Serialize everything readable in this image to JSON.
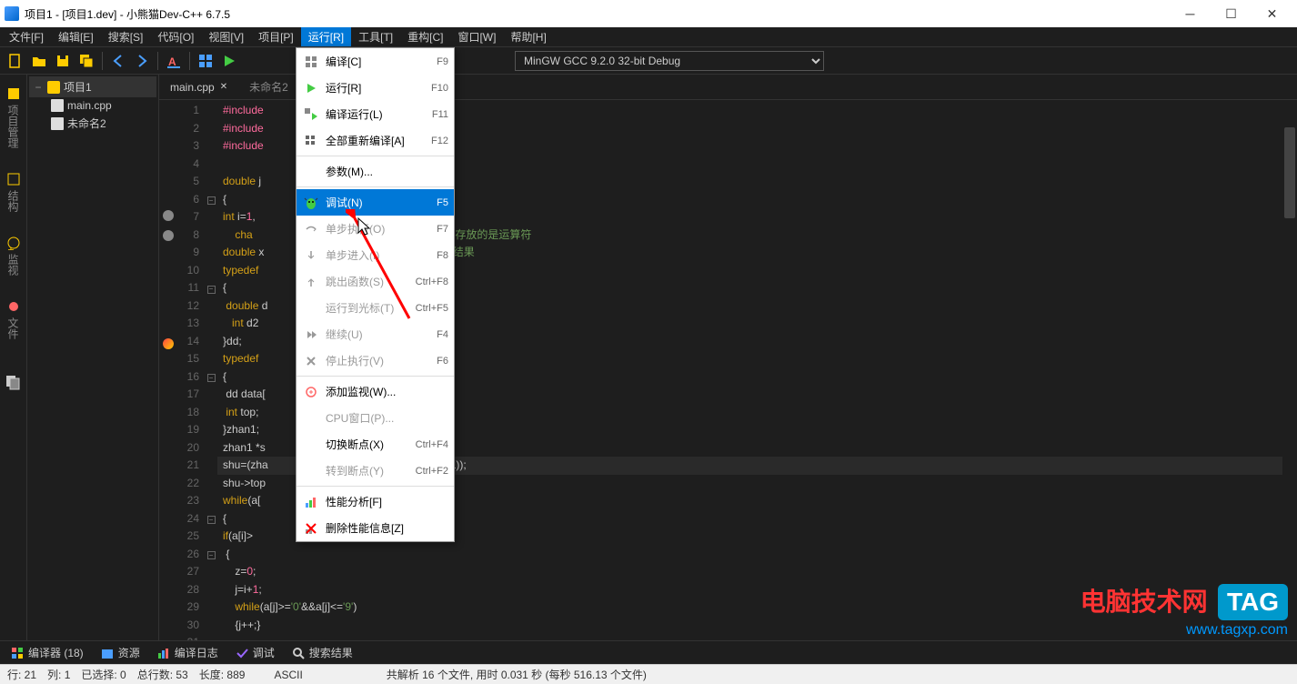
{
  "window": {
    "title": "项目1 - [项目1.dev] - 小熊猫Dev-C++ 6.7.5"
  },
  "menubar": [
    {
      "label": "文件[F]"
    },
    {
      "label": "编辑[E]"
    },
    {
      "label": "搜索[S]"
    },
    {
      "label": "代码[O]"
    },
    {
      "label": "视图[V]"
    },
    {
      "label": "项目[P]"
    },
    {
      "label": "运行[R]",
      "active": true
    },
    {
      "label": "工具[T]"
    },
    {
      "label": "重构[C]"
    },
    {
      "label": "窗口[W]"
    },
    {
      "label": "帮助[H]"
    }
  ],
  "compiler": "MinGW GCC 9.2.0 32-bit Debug",
  "sidebar_tabs": [
    "项目管理",
    "结构",
    "监视",
    "文件"
  ],
  "project_tree": {
    "root": "项目1",
    "files": [
      "main.cpp",
      "未命名2"
    ]
  },
  "editor_tabs": [
    {
      "label": "main.cpp",
      "active": true
    },
    {
      "label": "未命名2"
    }
  ],
  "run_menu": [
    {
      "label": "编译[C]",
      "shortcut": "F9",
      "icon": "compile"
    },
    {
      "label": "运行[R]",
      "shortcut": "F10",
      "icon": "run"
    },
    {
      "label": "编译运行(L)",
      "shortcut": "F11",
      "icon": "compile-run"
    },
    {
      "label": "全部重新编译[A]",
      "shortcut": "F12",
      "icon": "rebuild"
    },
    {
      "sep": true
    },
    {
      "label": "参数(M)...",
      "shortcut": ""
    },
    {
      "sep": true
    },
    {
      "label": "调试(N)",
      "shortcut": "F5",
      "icon": "debug",
      "highlight": true
    },
    {
      "label": "单步执行(O)",
      "shortcut": "F7",
      "icon": "step-over",
      "disabled": true
    },
    {
      "label": "单步进入(I)",
      "shortcut": "F8",
      "icon": "step-into",
      "disabled": true
    },
    {
      "label": "跳出函数(S)",
      "shortcut": "Ctrl+F8",
      "icon": "step-out",
      "disabled": true
    },
    {
      "label": "运行到光标(T)",
      "shortcut": "Ctrl+F5",
      "disabled": true
    },
    {
      "label": "继续(U)",
      "shortcut": "F4",
      "icon": "continue",
      "disabled": true
    },
    {
      "label": "停止执行(V)",
      "shortcut": "F6",
      "icon": "stop",
      "disabled": true
    },
    {
      "sep": true
    },
    {
      "label": "添加监视(W)...",
      "icon": "watch"
    },
    {
      "label": "CPU窗口(P)...",
      "disabled": true
    },
    {
      "label": "切换断点(X)",
      "shortcut": "Ctrl+F4"
    },
    {
      "label": "转到断点(Y)",
      "shortcut": "Ctrl+F2",
      "disabled": true
    },
    {
      "sep": true
    },
    {
      "label": "性能分析[F]",
      "icon": "profile"
    },
    {
      "label": "删除性能信息[Z]",
      "icon": "delete-profile"
    }
  ],
  "code": {
    "lines": [
      {
        "n": 1,
        "html": "<span class='pp'>#include</span>"
      },
      {
        "n": 2,
        "html": "<span class='pp'>#include</span>"
      },
      {
        "n": 3,
        "html": "<span class='pp'>#include</span>"
      },
      {
        "n": 4,
        "html": ""
      },
      {
        "n": 5,
        "html": "<span class='ty'>double</span> <span class='id'>j</span>"
      },
      {
        "n": 6,
        "html": "<span class='pun'>{</span>",
        "fold": "-"
      },
      {
        "n": 7,
        "html": "<span class='ty'>int</span> <span class='id'>i=</span><span class='num'>1</span><span class='pun'>,</span>",
        "bp": true,
        "tail": "<span class='num'>0</span><span class='pun'>,</span><span class='id'>t3=</span><span class='num'>0</span><span class='pun'>;</span>"
      },
      {
        "n": 8,
        "html": "    <span class='ty'>cha</span>",
        "bp": true,
        "tail": "<span class='com'>;//zhan2存放的是运算符</span>"
      },
      {
        "n": 9,
        "html": "<span class='ty'>double</span> <span class='id'>x</span>",
        "tail": "<span class='com'>/暂存结果</span>"
      },
      {
        "n": 10,
        "html": "<span class='kw'>typedef</span> "
      },
      {
        "n": 11,
        "html": "<span class='pun'>{</span>",
        "fold": "-"
      },
      {
        "n": 12,
        "html": " <span class='ty'>double</span> <span class='id'>d</span>"
      },
      {
        "n": 13,
        "html": "   <span class='ty'>int</span> <span class='id'>d2</span>"
      },
      {
        "n": 14,
        "html": "<span class='pun'>}</span><span class='id'>dd</span><span class='pun'>;</span>",
        "bp": "active"
      },
      {
        "n": 15,
        "html": "<span class='kw'>typedef</span> "
      },
      {
        "n": 16,
        "html": "<span class='pun'>{</span>",
        "fold": "-"
      },
      {
        "n": 17,
        "html": " <span class='id'>dd data[</span>"
      },
      {
        "n": 18,
        "html": " <span class='ty'>int</span> <span class='id'>top</span><span class='pun'>;</span>"
      },
      {
        "n": 19,
        "html": "<span class='pun'>}</span><span class='id'>zhan1</span><span class='pun'>;</span>"
      },
      {
        "n": 20,
        "html": "<span class='id'>zhan1 *s</span>"
      },
      {
        "n": 21,
        "html": "<span class='id'>shu=</span><span class='pun'>(</span><span class='id'>zha</span>",
        "hl": true,
        "tail": "<span class='id'>han1</span><span class='pun'>));</span>"
      },
      {
        "n": 22,
        "html": "<span class='id'>shu-&gt;top</span>"
      },
      {
        "n": 23,
        "html": "<span class='kw'>while</span><span class='pun'>(</span><span class='id'>a[</span>"
      },
      {
        "n": 24,
        "html": "<span class='pun'>{</span>",
        "fold": "-"
      },
      {
        "n": 25,
        "html": "<span class='kw'>if</span><span class='pun'>(</span><span class='id'>a[i]&gt;</span>"
      },
      {
        "n": 26,
        "html": " <span class='pun'>{</span>",
        "fold": "-"
      },
      {
        "n": 27,
        "html": "    <span class='id'>z=</span><span class='num'>0</span><span class='pun'>;</span>"
      },
      {
        "n": 28,
        "html": "    <span class='id'>j=i+</span><span class='num'>1</span><span class='pun'>;</span>"
      },
      {
        "n": 29,
        "html": "    <span class='kw'>while</span><span class='pun'>(</span><span class='id'>a[j]&gt;=</span><span class='str'>'0'</span><span class='op'>&amp;&amp;</span><span class='id'>a[j]&lt;=</span><span class='str'>'9'</span><span class='pun'>)</span>"
      },
      {
        "n": 30,
        "html": "    <span class='pun'>{</span><span class='id'>j++</span><span class='pun'>;}</span>"
      },
      {
        "n": 31,
        "html": "    "
      }
    ]
  },
  "bottom_tabs": [
    {
      "label": "编译器 (18)",
      "icon": "compiler"
    },
    {
      "label": "资源",
      "icon": "resource"
    },
    {
      "label": "编译日志",
      "icon": "log"
    },
    {
      "label": "调试",
      "icon": "debug"
    },
    {
      "label": "搜索结果",
      "icon": "search"
    }
  ],
  "statusbar": {
    "line": "行:  21",
    "col": "列:    1",
    "sel": "已选择:    0",
    "total": "总行数:   53",
    "len": "长度:   889",
    "encoding": "ASCII",
    "parse": "共解析 16 个文件, 用时 0.031 秒 (每秒 516.13 个文件)"
  },
  "watermark": {
    "main": "电脑技术网",
    "tag": "TAG",
    "url": "www.tagxp.com"
  }
}
